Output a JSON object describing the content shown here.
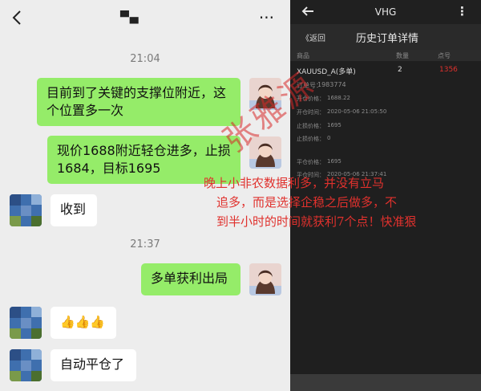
{
  "chat": {
    "title": "▀▄",
    "more": "···",
    "timestamps": [
      "21:04",
      "21:37"
    ],
    "messages": {
      "m1": "目前到了关键的支撑位附近，这个位置多一次",
      "m2": "现价1688附近轻仓进多，止损1684，目标1695",
      "m3": "收到",
      "m4": "多单获利出局",
      "m5": "👍👍👍",
      "m6": "自动平仓了"
    }
  },
  "trade": {
    "app_name": "VHG",
    "more": "⋮",
    "return_label": "《返回",
    "title": "历史订单详情",
    "headers": {
      "product": "商品",
      "qty": "数量",
      "code": "点号"
    },
    "symbol": "XAUUSD_A(多单)",
    "qty": "2",
    "points": "1356",
    "order_no_label": "订单号：",
    "order_no": "1983774",
    "rows": [
      {
        "label": "开仓价格：",
        "value": "1688.22"
      },
      {
        "label": "开仓时间：",
        "value": "2020-05-06 21:05:50"
      },
      {
        "label": "止损价格：",
        "value": "1695"
      },
      {
        "label": "止损价格：",
        "value": "0"
      },
      {
        "label": "平仓价格：",
        "value": "1695"
      },
      {
        "label": "平仓时间：",
        "value": "2020-05-06 21:37:41"
      }
    ]
  },
  "overlay": {
    "line1": "晚上小非农数据利多，并没有立马",
    "line2": "追多，而是选择企稳之后做多，不",
    "line3": "到半小时的时间就获利7个点！快准狠",
    "watermark": "张雅源"
  },
  "colors": {
    "my_bubble": "#95ec69",
    "their_bubble": "#ffffff",
    "chat_bg": "#ededed",
    "trade_bg": "#1f1f1f",
    "accent_red": "#e0312d"
  }
}
